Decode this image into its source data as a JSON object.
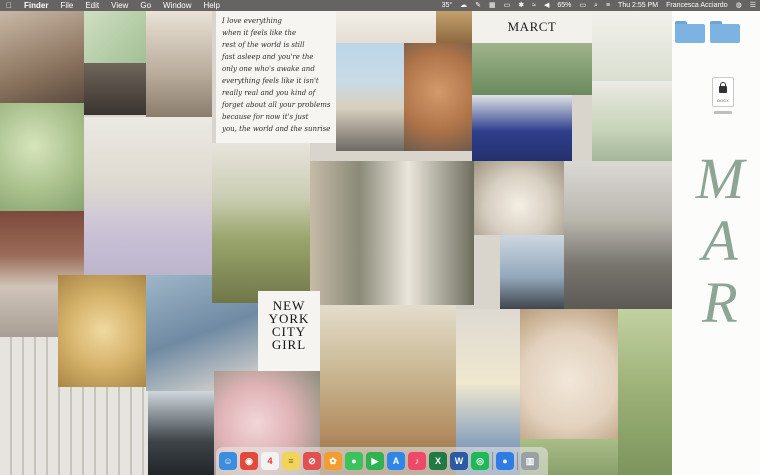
{
  "menubar": {
    "apple": "",
    "app": "Finder",
    "menus": [
      "File",
      "Edit",
      "View",
      "Go",
      "Window",
      "Help"
    ],
    "temperature": "35°",
    "battery": "65%",
    "clock": "Thu 2:55 PM",
    "user": "Francesca Acciardo"
  },
  "collage": {
    "note_lines": [
      "I love everything",
      "when it feels like the",
      "rest of the world is still",
      "fast asleep and you're the",
      "only one who's awake and",
      "everything feels like it isn't",
      "really real and you kind of",
      "forget about all your problems",
      "because for now it's just",
      "you, the world and the sunrise"
    ],
    "magazine": "MARCT",
    "nyc": [
      "NEW",
      "YORK",
      "CITY",
      "GIRL"
    ]
  },
  "desktop": {
    "folders": [
      "",
      ""
    ],
    "file_label": "DOCX",
    "mar_letters": [
      "M",
      "A",
      "R"
    ]
  },
  "dock": {
    "apps": [
      {
        "name": "finder",
        "glyph": "☺",
        "color": "#3b8ede"
      },
      {
        "name": "chrome",
        "glyph": "◉",
        "color": "#e3493a"
      },
      {
        "name": "calendar",
        "glyph": "4",
        "color": "#f2f2f2"
      },
      {
        "name": "notes",
        "glyph": "≡",
        "color": "#f3d45a"
      },
      {
        "name": "blocked",
        "glyph": "⊘",
        "color": "#e25050"
      },
      {
        "name": "photos",
        "glyph": "✿",
        "color": "#f39c32"
      },
      {
        "name": "messages",
        "glyph": "●",
        "color": "#3cc25a"
      },
      {
        "name": "facetime",
        "glyph": "▶",
        "color": "#2fb24f"
      },
      {
        "name": "app-store",
        "glyph": "A",
        "color": "#2f86e6"
      },
      {
        "name": "music",
        "glyph": "♪",
        "color": "#ee4a68"
      },
      {
        "name": "excel",
        "glyph": "X",
        "color": "#1f7a44"
      },
      {
        "name": "word",
        "glyph": "W",
        "color": "#2c5aa3"
      },
      {
        "name": "spotify",
        "glyph": "◎",
        "color": "#1db954"
      },
      {
        "name": "messenger",
        "glyph": "●",
        "color": "#2f7ce6"
      },
      {
        "name": "trash",
        "glyph": "▥",
        "color": "#9aa0a6"
      }
    ]
  }
}
